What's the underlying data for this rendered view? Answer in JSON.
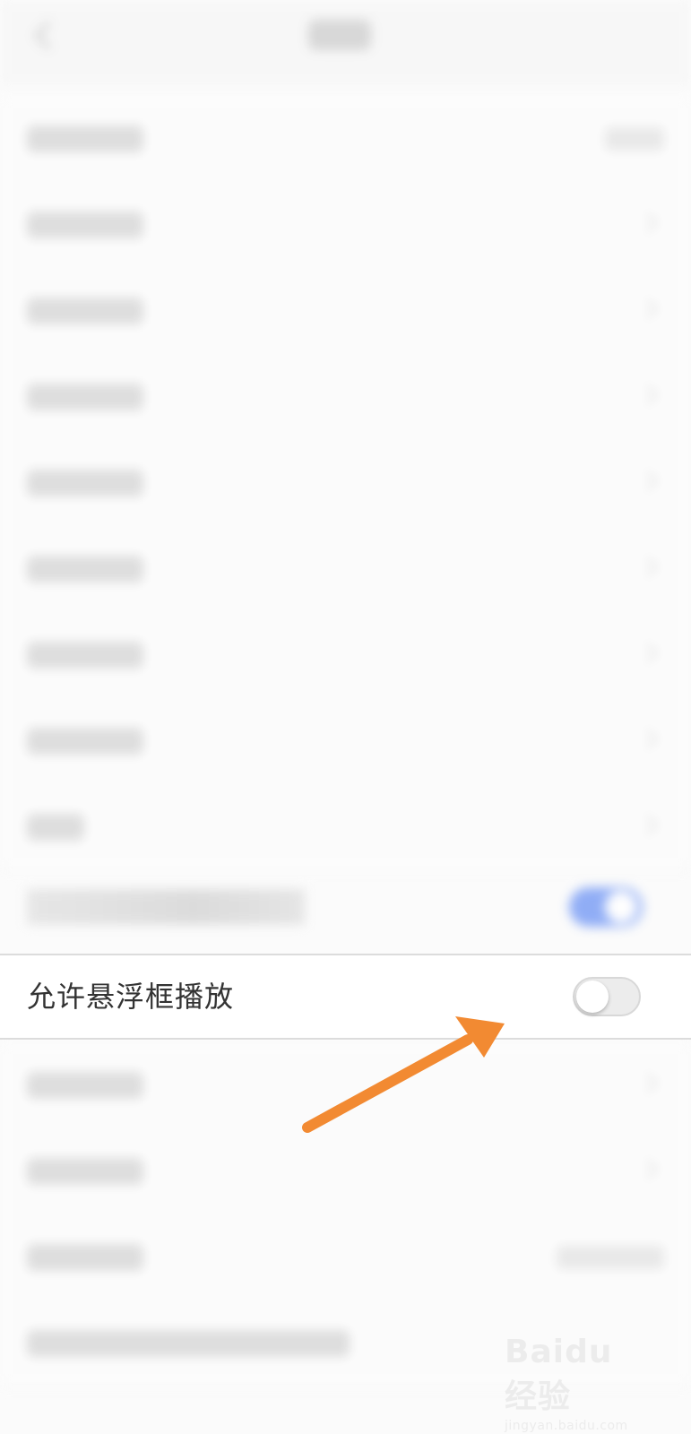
{
  "focused_setting": {
    "label": "允许悬浮框播放",
    "enabled": false
  },
  "colors": {
    "accent_toggle_on": "#7ea0f5",
    "annotation_arrow": "#f28a32",
    "toggle_off_track": "#ececec"
  },
  "icons": {
    "back": "back-chevron-icon",
    "row_chevron": "chevron-right-icon",
    "annotation": "orange-arrow-icon"
  },
  "watermark": {
    "main": "Baidu经验",
    "sub": "jingyan.baidu.com"
  }
}
